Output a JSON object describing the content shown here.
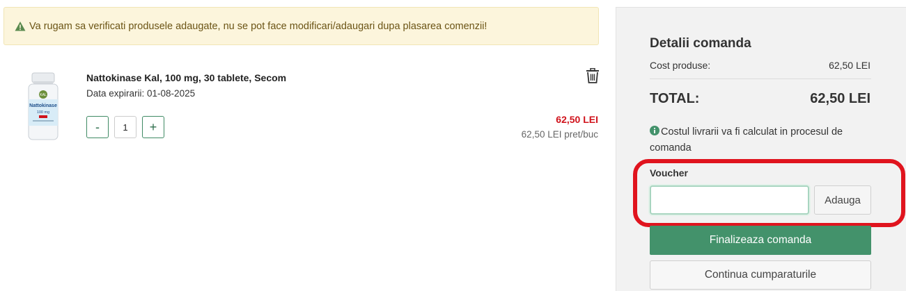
{
  "alert": {
    "icon": "warning-triangle-icon",
    "message": "Va rugam sa verificati produsele adaugate, nu se pot face modificari/adaugari dupa plasarea comenzii!",
    "color": "#6b5415",
    "background": "#fcf5dc"
  },
  "cart": {
    "items": [
      {
        "image_text": "Nattokinase",
        "image_subtext": "100 mg",
        "image_brand": "KAL",
        "name": "Nattokinase Kal, 100 mg, 30 tablete, Secom",
        "expiry": "Data expirarii: 01-08-2025",
        "quantity": "1",
        "minus_label": "-",
        "plus_label": "+",
        "total_price": "62,50 LEI",
        "unit_price": "62,50 LEI pret/buc",
        "delete_icon": "trash-icon"
      }
    ]
  },
  "summary": {
    "title": "Detalii comanda",
    "cost_label": "Cost produse:",
    "cost_value": "62,50 LEI",
    "total_label": "TOTAL:",
    "total_value": "62,50 LEI",
    "delivery_icon": "info-circle-icon",
    "delivery_note": "Costul livrarii va fi calculat in procesul de comanda",
    "voucher_label": "Voucher",
    "voucher_value": "",
    "voucher_button": "Adauga",
    "finalize_button": "Finalizeaza comanda",
    "continue_button": "Continua cumparaturile"
  },
  "colors": {
    "accent": "#43926b",
    "price": "#d0121b",
    "highlight": "#e0141e"
  }
}
